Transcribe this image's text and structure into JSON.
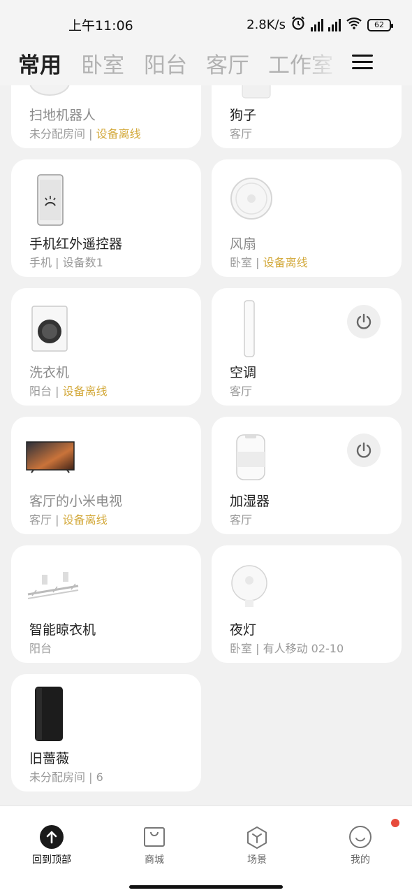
{
  "status_bar": {
    "time": "上午11:06",
    "net_speed": "2.8K/s",
    "battery": "62",
    "icons": [
      "alarm-icon",
      "hd-signal-icon",
      "hd-signal-icon",
      "wifi-icon",
      "battery-icon"
    ]
  },
  "tabs": [
    {
      "label": "常用",
      "active": true
    },
    {
      "label": "卧室"
    },
    {
      "label": "阳台"
    },
    {
      "label": "客厅"
    },
    {
      "label": "工作室"
    }
  ],
  "devices": [
    {
      "name": "扫地机器人",
      "room": "未分配房间",
      "status": "设备离线",
      "icon": "robot-vacuum-icon"
    },
    {
      "name": "狗子",
      "room": "客厅",
      "status": "",
      "icon": "device-icon"
    },
    {
      "name": "手机红外遥控器",
      "room": "手机",
      "status": "设备数1",
      "icon": "phone-remote-icon"
    },
    {
      "name": "风扇",
      "room": "卧室",
      "status": "设备离线",
      "icon": "fan-icon"
    },
    {
      "name": "洗衣机",
      "room": "阳台",
      "status": "设备离线",
      "icon": "washing-machine-icon"
    },
    {
      "name": "空调",
      "room": "客厅",
      "status": "",
      "icon": "air-conditioner-icon",
      "power": true
    },
    {
      "name": "客厅的小米电视",
      "room": "客厅",
      "status": "设备离线",
      "icon": "tv-icon"
    },
    {
      "name": "加湿器",
      "room": "客厅",
      "status": "",
      "icon": "humidifier-icon",
      "power": true
    },
    {
      "name": "智能晾衣机",
      "room": "阳台",
      "status": "",
      "icon": "clothes-dryer-icon"
    },
    {
      "name": "夜灯",
      "room": "卧室",
      "status": "有人移动 02-10",
      "icon": "night-light-icon"
    },
    {
      "name": "旧蔷薇",
      "room": "未分配房间",
      "status": "6",
      "icon": "router-icon"
    }
  ],
  "separator": " | ",
  "bottom_nav": [
    {
      "label": "回到顶部",
      "icon": "arrow-up-icon",
      "active": true
    },
    {
      "label": "商城",
      "icon": "shopping-bag-icon"
    },
    {
      "label": "场景",
      "icon": "scene-cube-icon"
    },
    {
      "label": "我的",
      "icon": "profile-icon",
      "badge": true
    }
  ],
  "colors": {
    "offline": "#d3a93b",
    "badge": "#e74b3c",
    "active_tab": "#222222",
    "inactive_tab": "#b2b2b2"
  }
}
